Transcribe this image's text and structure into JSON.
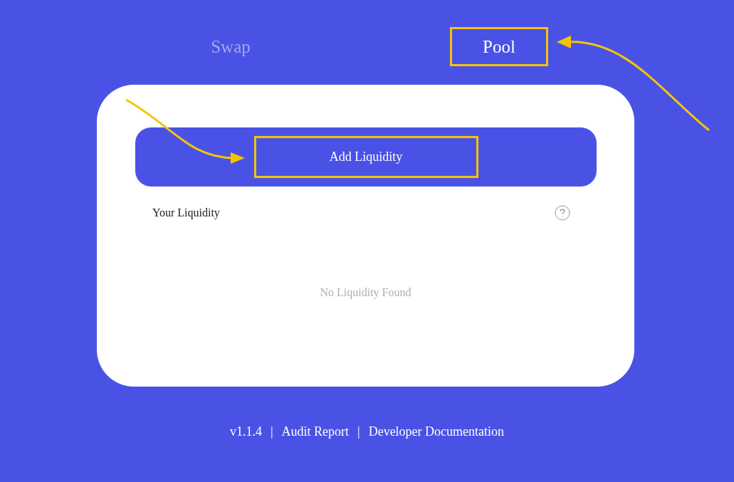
{
  "tabs": [
    {
      "label": "Swap",
      "selected": false,
      "highlighted": false
    },
    {
      "label": "Pool",
      "selected": true,
      "highlighted": true
    }
  ],
  "card": {
    "action": {
      "label": "Add Liquidity",
      "highlighted": true
    },
    "section_title": "Your Liquidity",
    "empty_message": "No Liquidity Found"
  },
  "footer": {
    "version": "v1.1.4",
    "separator": "|",
    "links": [
      "Audit Report",
      "Developer Documentation"
    ]
  }
}
